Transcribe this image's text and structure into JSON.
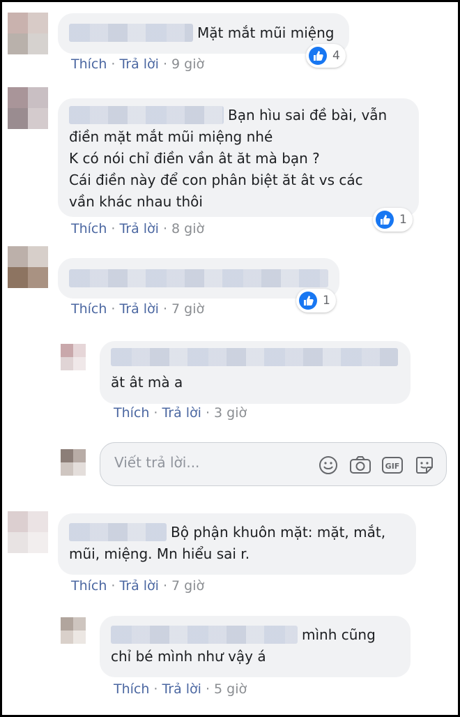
{
  "comments": [
    {
      "text_lines": [
        "Mặt mắt mũi miệng"
      ],
      "reaction_count": "4",
      "like_label": "Thích",
      "reply_label": "Trả lời",
      "time": "9 giờ"
    },
    {
      "text_lines": [
        "Bạn hìu sai đề bài, vẫn",
        "điền mặt mắt mũi miệng nhé",
        "K có nói chỉ điền vần ât ăt mà bạn ?",
        "Cái điền này để con phân biệt ăt ât vs các",
        "vần khác nhau thôi"
      ],
      "reaction_count": "1",
      "like_label": "Thích",
      "reply_label": "Trả lời",
      "time": "8 giờ"
    },
    {
      "text_lines": [],
      "reaction_count": "1",
      "like_label": "Thích",
      "reply_label": "Trả lời",
      "time": "7 giờ"
    },
    {
      "text_lines": [
        "ăt ât mà a"
      ],
      "like_label": "Thích",
      "reply_label": "Trả lời",
      "time": "3 giờ"
    },
    {
      "text_lines": [
        "Bộ phận khuôn mặt: mặt, mắt,",
        "mũi, miệng. Mn hiểu sai r."
      ],
      "like_label": "Thích",
      "reply_label": "Trả lời",
      "time": "7 giờ"
    },
    {
      "text_lines": [
        "mình cũng",
        "chỉ bé mình như vậy á"
      ],
      "like_label": "Thích",
      "reply_label": "Trả lời",
      "time": "5 giờ"
    }
  ],
  "reply_box": {
    "placeholder": "Viết trả lời...",
    "icons": [
      "emoji-icon",
      "camera-icon",
      "gif-icon",
      "sticker-icon"
    ]
  },
  "colors": {
    "bubble": "#f1f2f4",
    "link": "#4b67a1",
    "meta": "#8a8d91",
    "like_blue": "#1877f2"
  }
}
